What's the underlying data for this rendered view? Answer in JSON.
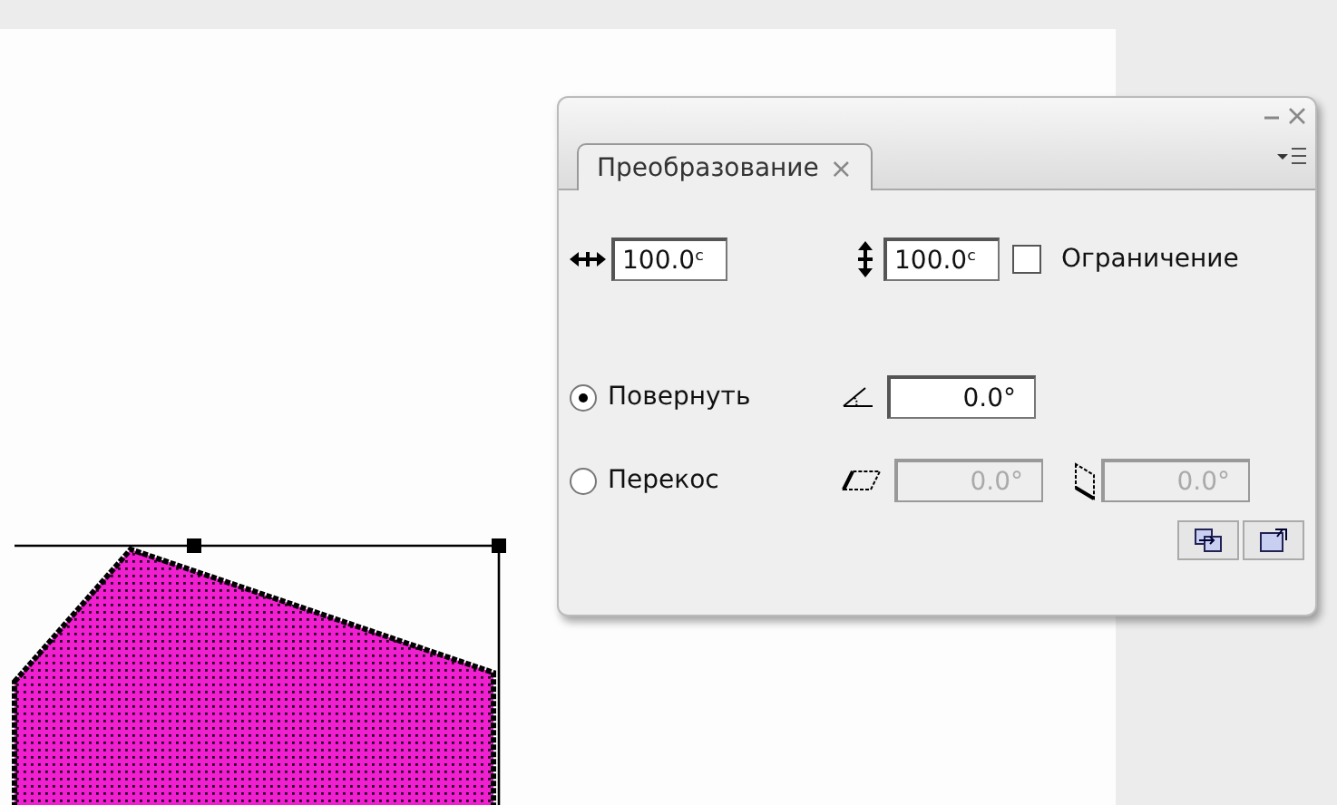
{
  "panel": {
    "tab": {
      "label": "Преобразование",
      "close": "×",
      "selected": true
    },
    "scale": {
      "width": "100.0ᶜ",
      "height": "100.0ᶜ",
      "constrain": {
        "label": "Ограничение",
        "checked": false
      }
    },
    "modes": [
      {
        "kind": "rotate",
        "label": "Повернуть",
        "selected": true,
        "fields": [
          {
            "value": "0.0°",
            "disabled": false
          }
        ]
      },
      {
        "kind": "skew",
        "label": "Перекос",
        "selected": false,
        "fields": [
          {
            "value": "0.0°",
            "disabled": true
          },
          {
            "value": "0.0°",
            "disabled": true
          }
        ]
      }
    ]
  }
}
